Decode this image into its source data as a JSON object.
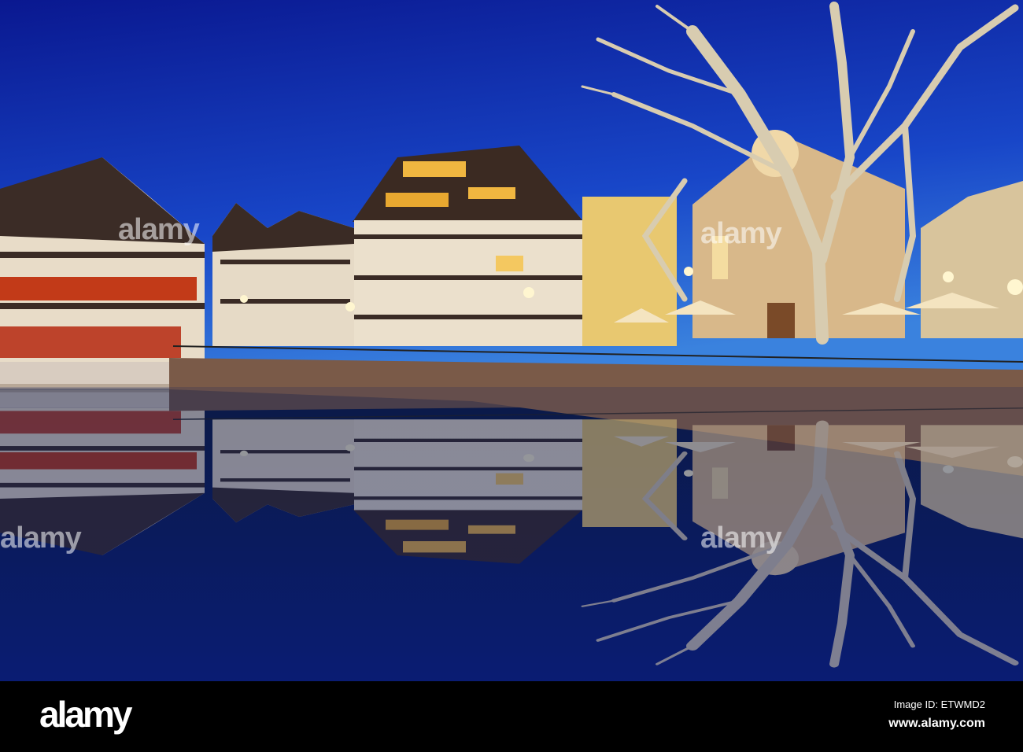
{
  "photo": {
    "subject": "Petite France canal at dusk",
    "colors": {
      "sky_top": "#0a1890",
      "sky_horizon": "#2e74d6",
      "water": "#06123f",
      "window_glow": "#ffb43a",
      "timber": "#3a2a22",
      "wall": "#8a6a55"
    }
  },
  "watermark": {
    "text": "alamy"
  },
  "footer": {
    "logo": "alamy",
    "image_id": "Image ID: ETWMD2",
    "url": "www.alamy.com"
  }
}
